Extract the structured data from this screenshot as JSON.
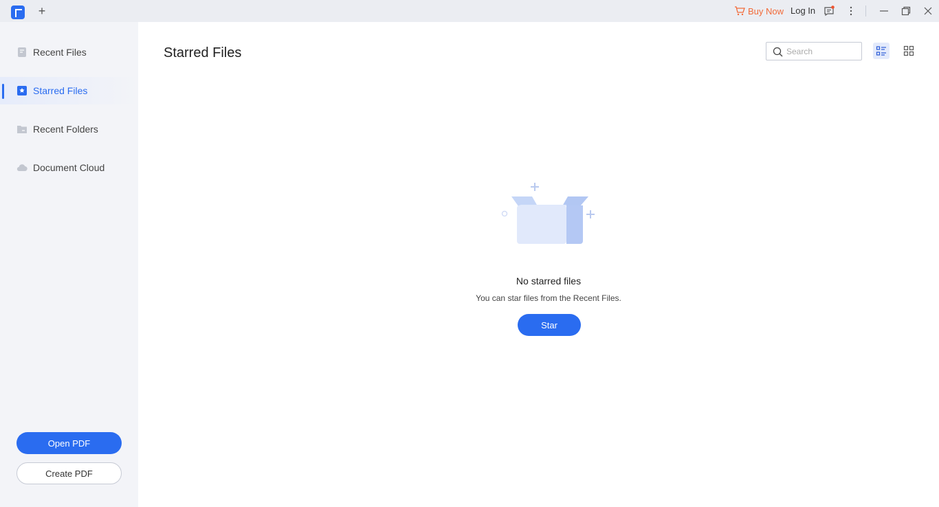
{
  "titlebar": {
    "buy_now_label": "Buy Now",
    "login_label": "Log In",
    "accent_color": "#2a6cf0",
    "buy_color": "#f26b3a"
  },
  "sidebar": {
    "items": [
      {
        "label": "Recent Files",
        "icon": "document-icon",
        "active": false
      },
      {
        "label": "Starred Files",
        "icon": "star-file-icon",
        "active": true
      },
      {
        "label": "Recent Folders",
        "icon": "folder-icon",
        "active": false
      },
      {
        "label": "Document Cloud",
        "icon": "cloud-icon",
        "active": false
      }
    ],
    "open_pdf_label": "Open PDF",
    "create_pdf_label": "Create PDF"
  },
  "main": {
    "title": "Starred Files",
    "search": {
      "placeholder": "Search",
      "value": ""
    },
    "empty_state": {
      "title": "No starred files",
      "subtitle": "You can star files from the Recent Files.",
      "button_label": "Star"
    }
  }
}
